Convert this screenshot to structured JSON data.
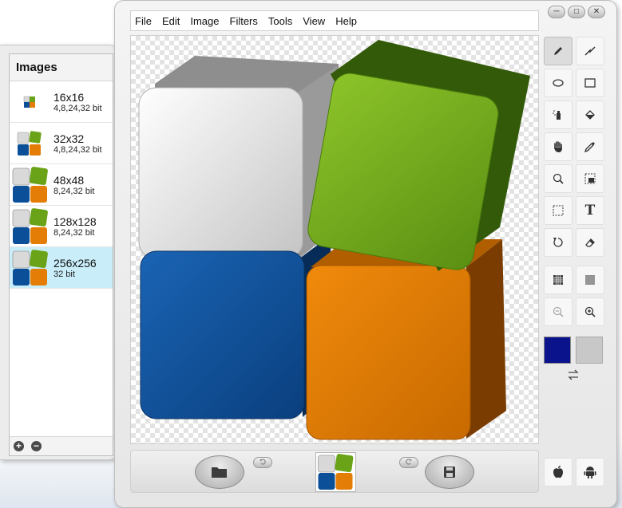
{
  "images_panel": {
    "title": "Images",
    "items": [
      {
        "size": "16x16",
        "bits": "4,8,24,32 bit",
        "selected": false
      },
      {
        "size": "32x32",
        "bits": "4,8,24,32 bit",
        "selected": false
      },
      {
        "size": "48x48",
        "bits": "8,24,32 bit",
        "selected": false
      },
      {
        "size": "128x128",
        "bits": "8,24,32 bit",
        "selected": false
      },
      {
        "size": "256x256",
        "bits": "32 bit",
        "selected": true
      }
    ],
    "add_symbol": "+",
    "remove_symbol": "−"
  },
  "window_controls": {
    "minimize": "─",
    "maximize": "□",
    "close": "✕"
  },
  "menu": [
    "File",
    "Edit",
    "Image",
    "Filters",
    "Tools",
    "View",
    "Help"
  ],
  "colors": {
    "primary_swatch": "#0b138c",
    "secondary_swatch": "#c8c8c8",
    "cube_gray": "#d9d9d9",
    "cube_green": "#6aa318",
    "cube_blue": "#0b4f98",
    "cube_orange": "#e47d05",
    "selection": "#c9eefa"
  },
  "tools": {
    "pencil": "pencil-icon",
    "line": "line-icon",
    "ellipse": "ellipse-icon",
    "rectangle": "rectangle-icon",
    "spray": "spray-icon",
    "fill": "fill-bucket-icon",
    "hand": "hand-icon",
    "picker": "color-picker-icon",
    "zoom": "magnifier-icon",
    "capture": "screen-capture-icon",
    "select": "selection-icon",
    "text": "T",
    "rotate": "rotate-icon",
    "eraser": "eraser-icon",
    "grid": "grid-icon",
    "checker": "checkerboard-icon",
    "zoom_out": "zoom-out-icon",
    "zoom_in": "zoom-in-icon"
  },
  "bottom": {
    "open_icon": "folder-icon",
    "save_icon": "save-icon",
    "undo_icon": "undo-icon",
    "redo_icon": "redo-icon"
  },
  "platforms": {
    "apple": "apple-icon",
    "android": "android-icon"
  }
}
